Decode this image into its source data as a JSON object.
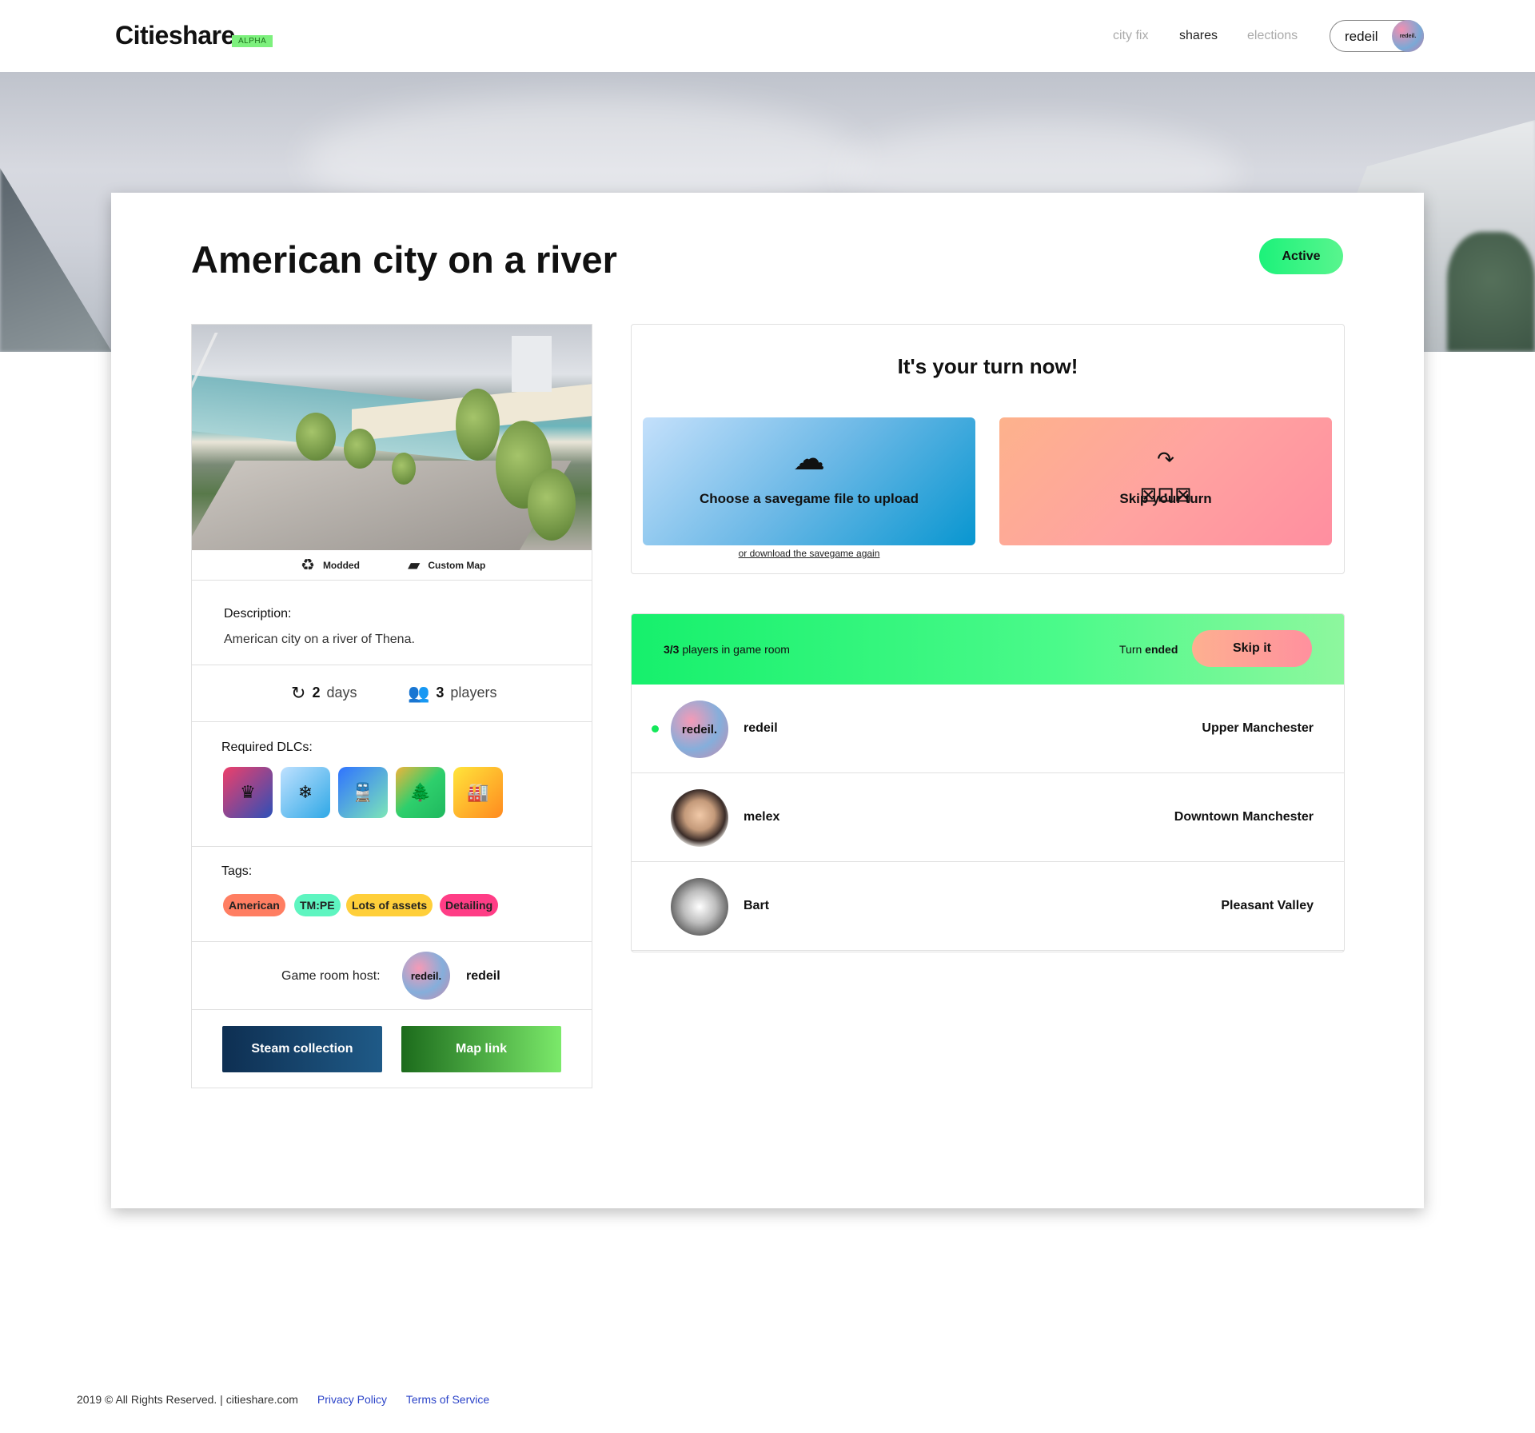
{
  "header": {
    "logo": "Citieshare",
    "badge": "ALPHA",
    "nav": [
      {
        "label": "city fix"
      },
      {
        "label": "shares"
      },
      {
        "label": "elections"
      }
    ],
    "user": {
      "name": "redeil",
      "avatar_text": "redeil."
    }
  },
  "room": {
    "title": "American city on a river",
    "status": "Active",
    "badges": {
      "modded": "Modded",
      "custom_map": "Custom Map"
    },
    "description_label": "Description:",
    "description": "American city on a river of Thena.",
    "stats": {
      "days_value": "2",
      "days_label": "days",
      "players_value": "3",
      "players_label": "players"
    },
    "dlc_label": "Required DLCs:",
    "dlcs": [
      {
        "icon": "party-icon",
        "glyph": "♠"
      },
      {
        "icon": "snowflake-icon",
        "glyph": "❄"
      },
      {
        "icon": "train-icon",
        "glyph": "🚆"
      },
      {
        "icon": "tree-icon",
        "glyph": "🌲"
      },
      {
        "icon": "factory-icon",
        "glyph": "🏭"
      }
    ],
    "tags_label": "Tags:",
    "tags": [
      {
        "label": "American",
        "color": "#ff7e62"
      },
      {
        "label": "TM:PE",
        "color": "#5ef5c0"
      },
      {
        "label": "Lots of assets",
        "color": "#ffcf3a"
      },
      {
        "label": "Detailing",
        "color": "#ff3d86"
      }
    ],
    "host_label": "Game room host:",
    "host_name": "redeil",
    "host_avatar_text": "redeil.",
    "buttons": {
      "steam": "Steam collection",
      "map": "Map link"
    }
  },
  "turn": {
    "heading": "It's your turn now!",
    "upload_label": "Choose a savegame file to upload",
    "redownload": "or download the savegame again",
    "skip_label": "Skip your turn"
  },
  "players": {
    "count": "3/3",
    "count_suffix": "players in game room",
    "turn_prefix": "Turn",
    "turn_status": "ended",
    "skip_button": "Skip it",
    "list": [
      {
        "name": "redeil",
        "city": "Upper Manchester",
        "avatar_text": "redeil.",
        "online": true
      },
      {
        "name": "melex",
        "city": "Downtown Manchester",
        "avatar_text": "",
        "online": false
      },
      {
        "name": "Bart",
        "city": "Pleasant Valley",
        "avatar_text": "",
        "online": false
      }
    ]
  },
  "footer": {
    "copyright": "2019 © All Rights Reserved. | citieshare.com",
    "links": [
      "Privacy Policy",
      "Terms of Service"
    ]
  }
}
